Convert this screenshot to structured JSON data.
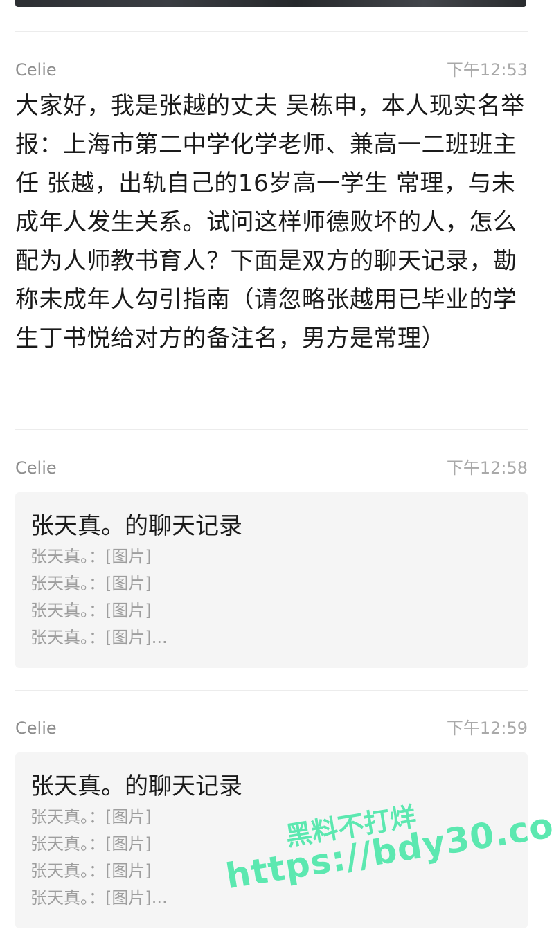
{
  "messages": [
    {
      "sender": "Celie",
      "time": "下午12:53",
      "text": "大家好，我是张越的丈夫 吴栋申，本人现实名举报：上海市第二中学化学老师、兼高一二班班主任 张越，出轨自己的16岁高一学生 常理，与未成年人发生关系。试问这样师德败坏的人，怎么配为人师教书育人？下面是双方的聊天记录，勘称未成年人勾引指南（请忽略张越用已毕业的学生丁书悦给对方的备注名，男方是常理）"
    },
    {
      "sender": "Celie",
      "time": "下午12:58",
      "card": {
        "title": "张天真。的聊天记录",
        "lines": [
          "张天真。：[图片]",
          "张天真。：[图片]",
          "张天真。：[图片]",
          "张天真。：[图片]..."
        ]
      }
    },
    {
      "sender": "Celie",
      "time": "下午12:59",
      "card": {
        "title": "张天真。的聊天记录",
        "lines": [
          "张天真。：[图片]",
          "张天真。：[图片]",
          "张天真。：[图片]",
          "张天真。：[图片]..."
        ]
      }
    }
  ],
  "watermark": {
    "line1": "黑料不打烊",
    "line2": "https://bdy30.co"
  }
}
